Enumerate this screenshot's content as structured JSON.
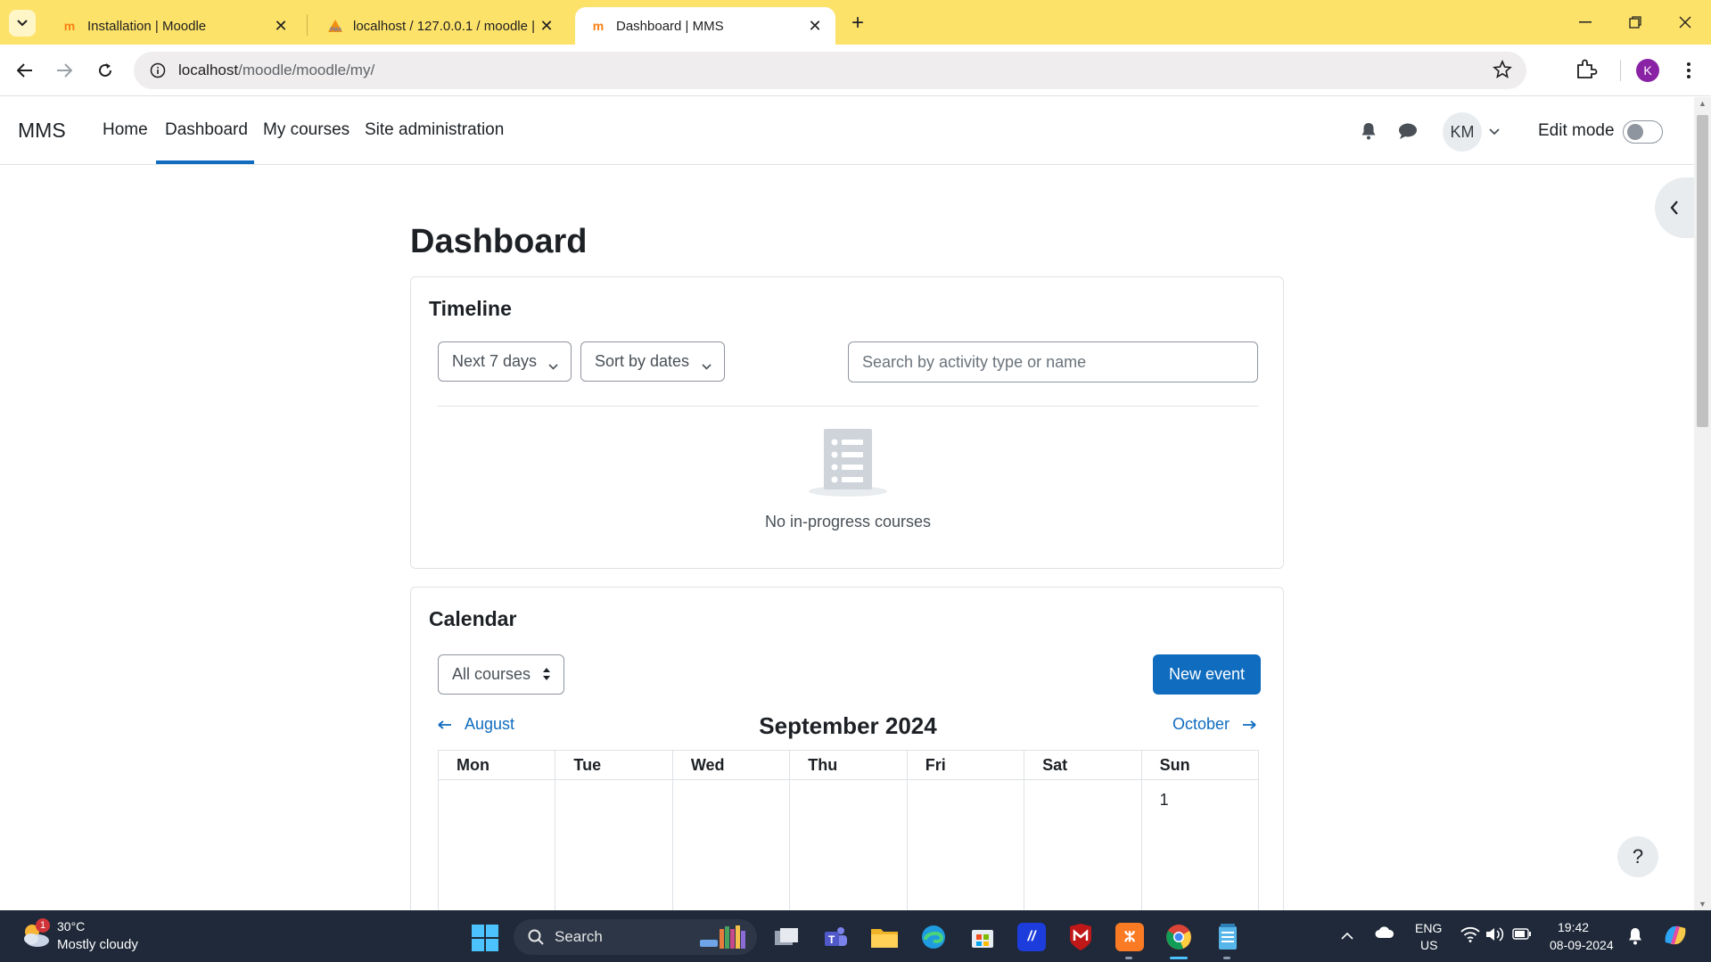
{
  "browser": {
    "tabs": [
      {
        "title": "Installation | Moodle",
        "favicon": "moodle-icon"
      },
      {
        "title": "localhost / 127.0.0.1 / moodle |",
        "favicon": "phpmyadmin-icon"
      },
      {
        "title": "Dashboard | MMS",
        "favicon": "moodle-icon"
      }
    ],
    "url_host": "localhost",
    "url_path": "/moodle/moodle/my/",
    "profile_initial": "K"
  },
  "moodle": {
    "brand": "MMS",
    "nav": [
      "Home",
      "Dashboard",
      "My courses",
      "Site administration"
    ],
    "active_nav": "Dashboard",
    "user_initials": "KM",
    "edit_mode_label": "Edit mode",
    "edit_mode_on": false
  },
  "page": {
    "title": "Dashboard",
    "timeline": {
      "title": "Timeline",
      "filter": "Next 7 days",
      "sort": "Sort by dates",
      "search_placeholder": "Search by activity type or name",
      "empty_message": "No in-progress courses"
    },
    "calendar": {
      "title": "Calendar",
      "course_filter": "All courses",
      "new_event": "New event",
      "prev_month": "August",
      "next_month": "October",
      "month": "September 2024",
      "weekdays": [
        "Mon",
        "Tue",
        "Wed",
        "Thu",
        "Fri",
        "Sat",
        "Sun"
      ],
      "first_row": [
        "",
        "",
        "",
        "",
        "",
        "",
        "1"
      ]
    },
    "help": "?"
  },
  "taskbar": {
    "weather_temp": "30°C",
    "weather_desc": "Mostly cloudy",
    "weather_badge": "1",
    "search_label": "Search",
    "lang_top": "ENG",
    "lang_bottom": "US",
    "time": "19:42",
    "date": "08-09-2024"
  },
  "colors": {
    "tabstrip": "#fde26a",
    "moodle_primary": "#0f6cbf",
    "taskbar": "#1f2939"
  }
}
